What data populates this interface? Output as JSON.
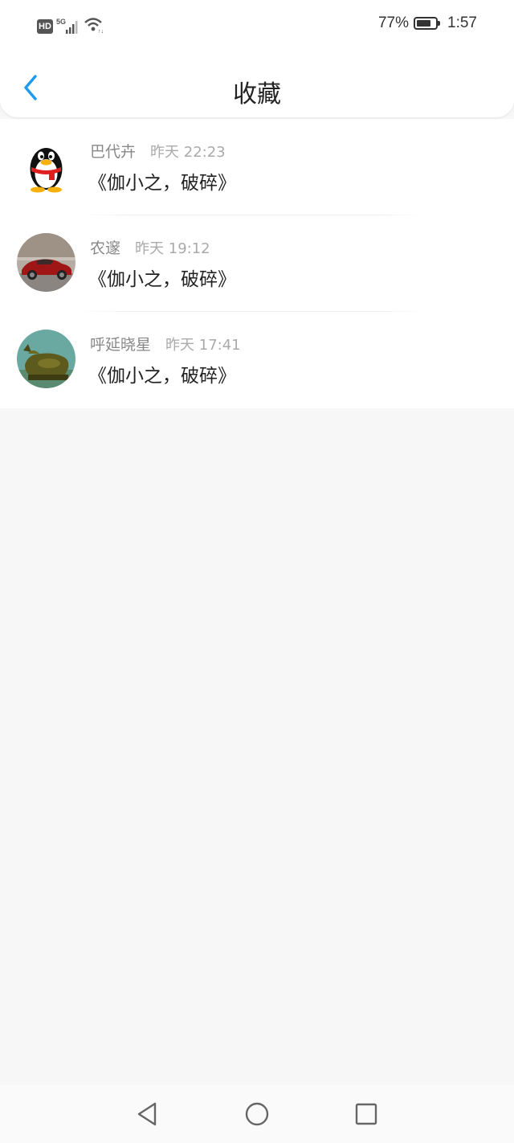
{
  "status_bar": {
    "network_left": "HD",
    "network_type": "5G",
    "battery_text": "77%",
    "battery_level": 0.77,
    "time": "1:57"
  },
  "header": {
    "title": "收藏",
    "back_icon": "chevron-left-icon"
  },
  "favorites": [
    {
      "name": "巴代卉",
      "time": "昨天 22:23",
      "content": "《伽小之，破碎》",
      "avatar": "qq-penguin-avatar"
    },
    {
      "name": "农邃",
      "time": "昨天 19:12",
      "content": "《伽小之，破碎》",
      "avatar": "red-car-avatar"
    },
    {
      "name": "呼延晓星",
      "time": "昨天 17:41",
      "content": "《伽小之，破碎》",
      "avatar": "bronze-ox-avatar"
    }
  ],
  "nav_bar": {
    "back": "triangle-back-icon",
    "home": "circle-home-icon",
    "recents": "square-recents-icon"
  },
  "colors": {
    "accent": "#1e9af0",
    "background": "#f8f7f8"
  }
}
